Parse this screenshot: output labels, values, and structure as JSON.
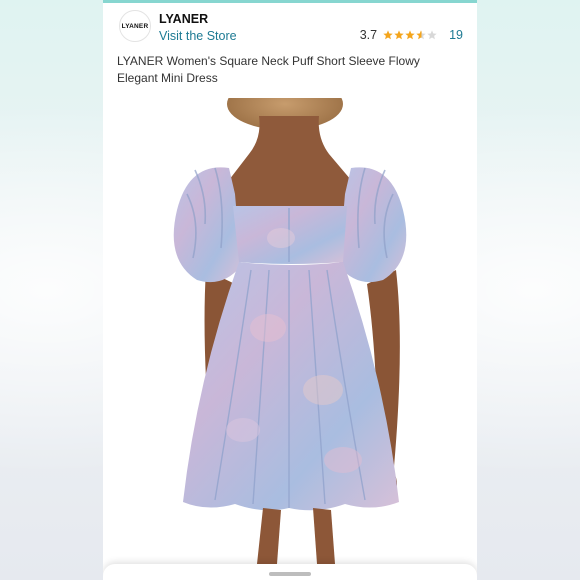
{
  "header": {
    "logo_text": "LYANER",
    "brand": "LYANER",
    "visit_store": "Visit the Store",
    "rating": 3.7,
    "rating_text": "3.7",
    "rating_count": "19",
    "stars": {
      "full": 3,
      "half": 1,
      "empty": 1
    },
    "title": "LYANER Women's Square Neck Puff Short Sleeve Flowy Elegant Mini Dress"
  },
  "colors": {
    "accent_link": "#1d7a93",
    "star_fill": "#f4a51c",
    "star_empty": "#d8d8d8",
    "top_accent": "#87d6d0",
    "dress_base": "#a8b8dd",
    "dress_pink": "#e8bdd0",
    "skin": "#8f5a3b"
  },
  "icons": {
    "star_full": "star-full-icon",
    "star_half": "star-half-icon",
    "star_empty": "star-empty-icon",
    "drag_handle": "drag-handle-icon"
  }
}
